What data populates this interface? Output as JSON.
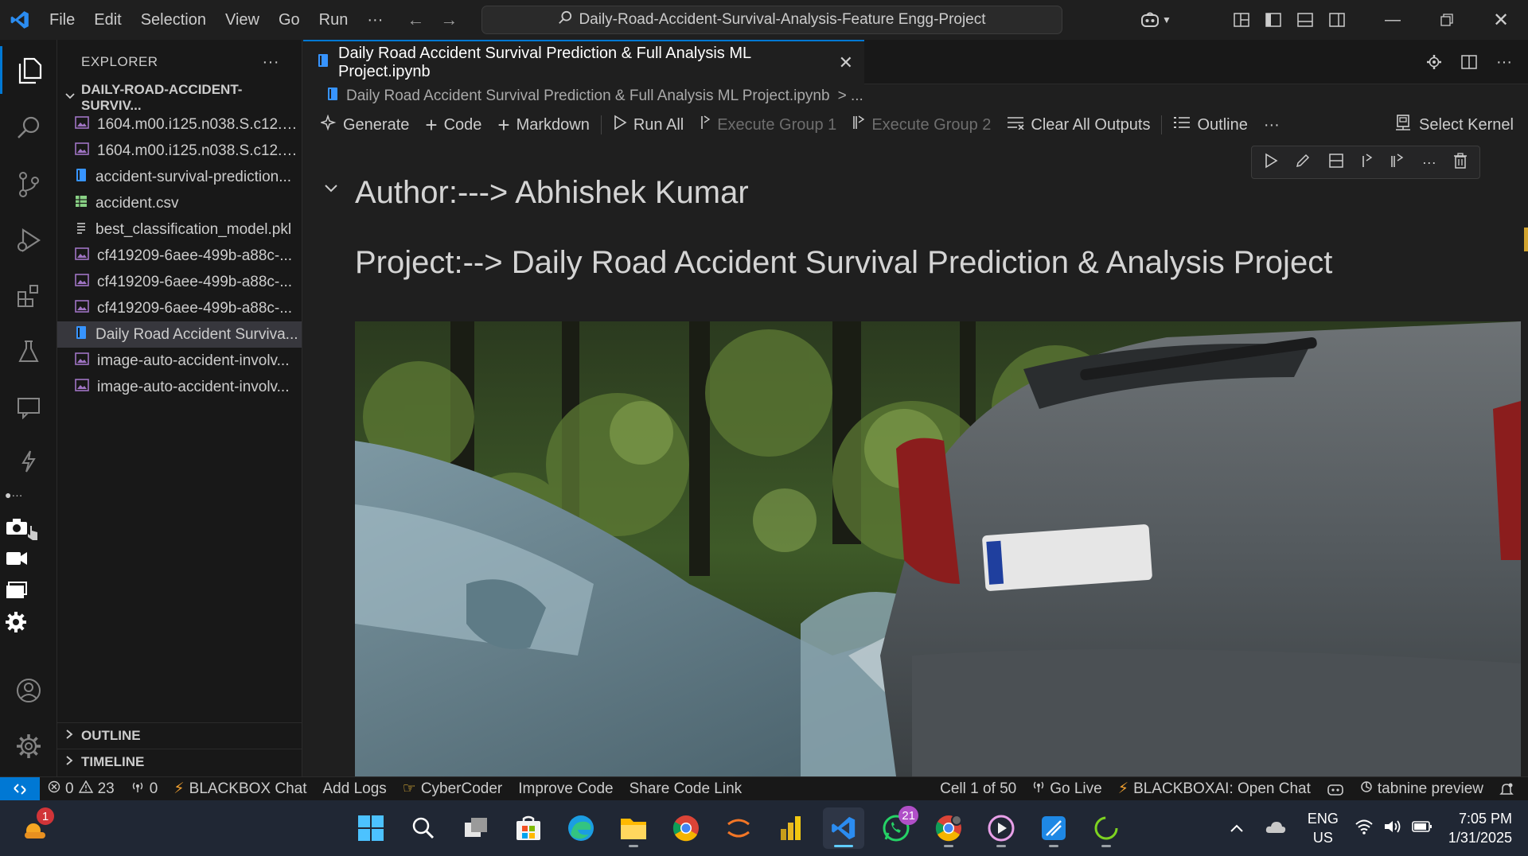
{
  "window": {
    "menu": [
      "File",
      "Edit",
      "Selection",
      "View",
      "Go",
      "Run",
      "···"
    ],
    "search_text": "Daily-Road-Accident-Survival-Analysis-Feature Engg-Project"
  },
  "sidebar": {
    "title": "EXPLORER",
    "folder": "DAILY-ROAD-ACCIDENT-SURVIV...",
    "files": [
      {
        "name": "1604.m00.i125.n038.S.c12.3...",
        "icon": "image-file-icon",
        "color": "#a074c4"
      },
      {
        "name": "1604.m00.i125.n038.S.c12.3...",
        "icon": "image-file-icon",
        "color": "#a074c4"
      },
      {
        "name": "accident-survival-prediction...",
        "icon": "notebook-file-icon",
        "color": "#3794ff"
      },
      {
        "name": "accident.csv",
        "icon": "csv-file-icon",
        "color": "#89d185"
      },
      {
        "name": "best_classification_model.pkl",
        "icon": "text-file-icon",
        "color": "#cccccc"
      },
      {
        "name": "cf419209-6aee-499b-a88c-...",
        "icon": "image-file-icon",
        "color": "#a074c4"
      },
      {
        "name": "cf419209-6aee-499b-a88c-...",
        "icon": "image-file-icon",
        "color": "#a074c4"
      },
      {
        "name": "cf419209-6aee-499b-a88c-...",
        "icon": "image-file-icon",
        "color": "#a074c4"
      },
      {
        "name": "Daily Road Accident Surviva...",
        "icon": "notebook-file-icon",
        "color": "#3794ff"
      },
      {
        "name": "image-auto-accident-involv...",
        "icon": "image-file-icon",
        "color": "#a074c4"
      },
      {
        "name": "image-auto-accident-involv...",
        "icon": "image-file-icon",
        "color": "#a074c4"
      }
    ],
    "outline": "OUTLINE",
    "timeline": "TIMELINE"
  },
  "editor": {
    "tab_title": "Daily Road Accident Survival Prediction & Full Analysis ML Project.ipynb",
    "breadcrumb_file": "Daily Road Accident Survival Prediction & Full Analysis ML Project.ipynb",
    "breadcrumb_more": "> ...",
    "toolbar": {
      "generate": "Generate",
      "code": "Code",
      "markdown": "Markdown",
      "run_all": "Run All",
      "exec_group1": "Execute Group 1",
      "exec_group2": "Execute Group 2",
      "clear_outputs": "Clear All Outputs",
      "outline": "Outline",
      "more": "···",
      "select_kernel": "Select Kernel"
    },
    "cell": {
      "heading1": "Author:---> Abhishek Kumar",
      "heading2": "Project:--> Daily Road Accident Survival Prediction & Analysis Project"
    }
  },
  "statusbar": {
    "errors": "0",
    "warnings": "23",
    "ports": "0",
    "blackbox_chat": "BLACKBOX Chat",
    "add_logs": "Add Logs",
    "cybercoder": "CyberCoder",
    "improve_code": "Improve Code",
    "share_code": "Share Code Link",
    "cell_pos": "Cell 1 of 50",
    "go_live": "Go Live",
    "blackboxai": "BLACKBOXAI: Open Chat",
    "tabnine": "tabnine preview"
  },
  "taskbar": {
    "weather_badge": "1",
    "whatsapp_badge": "21",
    "lang_line1": "ENG",
    "lang_line2": "US",
    "time": "7:05 PM",
    "date": "1/31/2025"
  }
}
